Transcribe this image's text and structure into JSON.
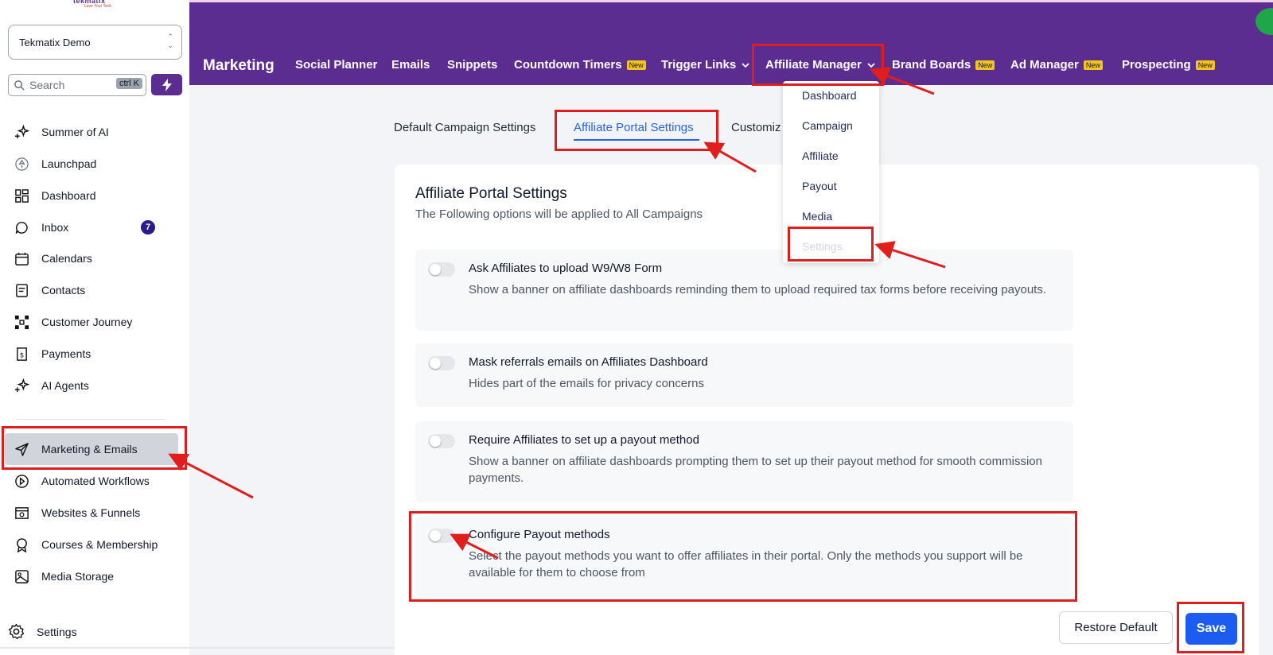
{
  "sidebar": {
    "logo_text": "tekmatix",
    "logo_tagline": "Love Your Tech",
    "account_name": "Tekmatix Demo",
    "search_placeholder": "Search",
    "search_shortcut": "ctrl K",
    "items": [
      {
        "label": "Summer of AI",
        "icon": "sparkle-icon"
      },
      {
        "label": "Launchpad",
        "icon": "rocket-icon"
      },
      {
        "label": "Dashboard",
        "icon": "dashboard-icon"
      },
      {
        "label": "Inbox",
        "icon": "chat-bubble-icon",
        "badge": "7"
      },
      {
        "label": "Calendars",
        "icon": "calendar-icon"
      },
      {
        "label": "Contacts",
        "icon": "contacts-icon"
      },
      {
        "label": "Customer Journey",
        "icon": "journey-icon"
      },
      {
        "label": "Payments",
        "icon": "payments-icon"
      },
      {
        "label": "AI Agents",
        "icon": "sparkle-icon"
      },
      {
        "label": "Marketing & Emails",
        "icon": "send-icon",
        "active": true
      },
      {
        "label": "Automated Workflows",
        "icon": "workflow-icon"
      },
      {
        "label": "Websites & Funnels",
        "icon": "website-icon"
      },
      {
        "label": "Courses & Membership",
        "icon": "award-icon"
      },
      {
        "label": "Media Storage",
        "icon": "image-icon"
      }
    ],
    "settings_label": "Settings"
  },
  "header": {
    "brand": "Marketing",
    "tabs": [
      {
        "label": "Social Planner"
      },
      {
        "label": "Emails"
      },
      {
        "label": "Snippets"
      },
      {
        "label": "Countdown Timers",
        "badge": "New"
      },
      {
        "label": "Trigger Links",
        "dropdown": true
      },
      {
        "label": "Affiliate Manager",
        "dropdown": true,
        "active": true
      },
      {
        "label": "Brand Boards",
        "badge": "New"
      },
      {
        "label": "Ad Manager",
        "badge": "New"
      },
      {
        "label": "Prospecting",
        "badge": "New"
      }
    ]
  },
  "affiliate_dropdown": {
    "items": [
      "Dashboard",
      "Campaign",
      "Affiliate",
      "Payout",
      "Media",
      "Settings"
    ]
  },
  "subtabs": {
    "items": [
      "Default Campaign Settings",
      "Affiliate Portal Settings",
      "Customiz"
    ],
    "active": "Affiliate Portal Settings"
  },
  "card": {
    "title": "Affiliate Portal Settings",
    "subtitle": "The Following options will be applied to All Campaigns",
    "options": [
      {
        "title": "Ask Affiliates to upload W9/W8 Form",
        "desc": "Show a banner on affiliate dashboards reminding them to upload required tax forms before receiving payouts.",
        "enabled": false
      },
      {
        "title": "Mask referrals emails on Affiliates Dashboard",
        "desc": "Hides part of the emails for privacy concerns",
        "enabled": false
      },
      {
        "title": "Require Affiliates to set up a payout method",
        "desc": "Show a banner on affiliate dashboards prompting them to set up their payout method for smooth commission payments.",
        "enabled": false
      },
      {
        "title": "Configure Payout methods",
        "desc": "Select the payout methods you want to offer affiliates in their portal. Only the methods you support will be available for them to choose from",
        "enabled": false
      }
    ],
    "restore_label": "Restore Default",
    "save_label": "Save"
  },
  "colors": {
    "header_bg": "#5b2d91",
    "accent_blue": "#2563eb",
    "save_blue": "#1d5cf0",
    "annotation_red": "#e01e1e",
    "badge_yellow": "#f5c518"
  }
}
